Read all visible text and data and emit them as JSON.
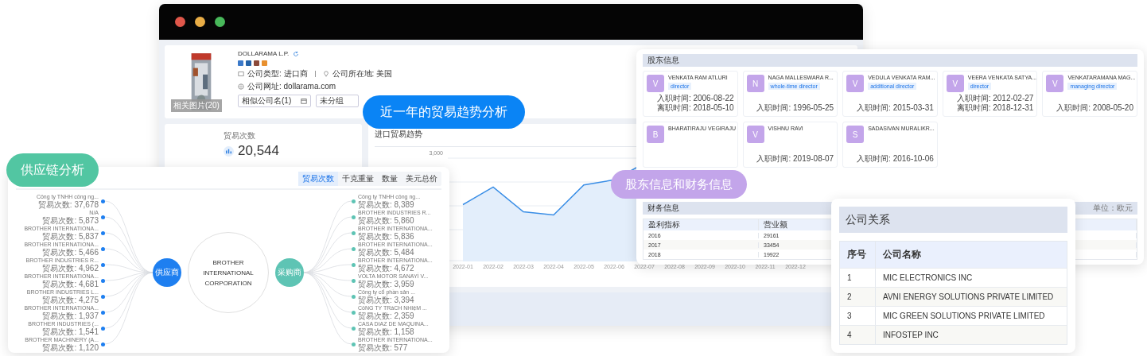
{
  "callouts": [
    {
      "label": "近一年的贸易趋势分析",
      "color": "#0a84f5"
    },
    {
      "label": "供应链分析",
      "color": "#52c6a2"
    },
    {
      "label": "股东信息和财务信息",
      "color": "#c3a5ea"
    }
  ],
  "company": {
    "name": "DOLLARAMA L.P.",
    "photo_caption": "相关图片(20)",
    "type": "公司类型: 进口商",
    "location": "公司所在地: 美国",
    "website": "公司网址: dollarama.com",
    "selects": [
      "相似公司名(1)",
      "未分组"
    ]
  },
  "stats": {
    "label": "贸易次数",
    "value": "20,544"
  },
  "trend": {
    "title": "进口贸易趋势",
    "y_tick": "3,000",
    "x_labels": [
      "2022-01",
      "2022-02",
      "2022-03",
      "2022-04",
      "2022-05",
      "2022-06",
      "2022-07",
      "2022-08",
      "2022-09",
      "2022-10",
      "2022-11",
      "2022-12"
    ]
  },
  "supply_chain": {
    "tabs": [
      {
        "label": "贸易次数",
        "selected": true
      },
      {
        "label": "千克重量",
        "selected": false
      },
      {
        "label": "数量",
        "selected": false
      },
      {
        "label": "美元总价",
        "selected": false
      }
    ],
    "center": "BROTHER INTERNATIONAL CORPORATION",
    "supplier_label": "供应商",
    "buyer_label": "采购商",
    "suppliers": [
      {
        "name": "Công ty TNHH công ng...",
        "count": "贸易次数: 37,678"
      },
      {
        "name": "N/A",
        "count": "贸易次数: 5,873"
      },
      {
        "name": "BROTHER INTERNATIONA...",
        "count": "贸易次数: 5,837"
      },
      {
        "name": "BROTHER INTERNATIONA...",
        "count": "贸易次数: 5,466"
      },
      {
        "name": "BROTHER INDUSTRIES R...",
        "count": "贸易次数: 4,962"
      },
      {
        "name": "BROTHER INTERNATIONA...",
        "count": "贸易次数: 4,681"
      },
      {
        "name": "BROTHER INDUSTRIES L...",
        "count": "贸易次数: 4,275"
      },
      {
        "name": "BROTHER INTERNATIONA...",
        "count": "贸易次数: 1,937"
      },
      {
        "name": "BROTHER INDUSTRIES (...",
        "count": "贸易次数: 1,541"
      },
      {
        "name": "BROTHER MACHINERY (A...",
        "count": "贸易次数: 1,120"
      }
    ],
    "buyers": [
      {
        "name": "Công ty TNHH công ng...",
        "count": "贸易次数: 8,389"
      },
      {
        "name": "BROTHER INDUSTRIES R...",
        "count": "贸易次数: 5,860"
      },
      {
        "name": "BROTHER INTERNATIONA...",
        "count": "贸易次数: 5,836"
      },
      {
        "name": "BROTHER INTERNATIONA...",
        "count": "贸易次数: 5,484"
      },
      {
        "name": "BROTHER INTERNATIONA...",
        "count": "贸易次数: 4,672"
      },
      {
        "name": "VOLTA MOTOR SANAYİ V...",
        "count": "贸易次数: 3,959"
      },
      {
        "name": "Công ty cổ phần sản ...",
        "count": "贸易次数: 3,394"
      },
      {
        "name": "CôNG TY TRáCH NHIệM ...",
        "count": "贸易次数: 2,359"
      },
      {
        "name": "CASA DIAZ DE MAQUINA...",
        "count": "贸易次数: 1,158"
      },
      {
        "name": "BROTHER INTERNATIONA...",
        "count": "贸易次数: 577"
      }
    ]
  },
  "shareholders": {
    "title": "股东信息",
    "people": [
      {
        "initial": "V",
        "name": "VENKATA RAM ATLURI",
        "role": "director",
        "dates": [
          "入职时间: 2006-08-22",
          "离职时间: 2018-05-10"
        ]
      },
      {
        "initial": "N",
        "name": "NAGA MALLESWARA R...",
        "role": "whole-time director",
        "dates": [
          "入职时间: 1996-05-25"
        ]
      },
      {
        "initial": "V",
        "name": "VEDULA VENKATA RAM...",
        "role": "additional director",
        "dates": [
          "入职时间: 2015-03-31"
        ]
      },
      {
        "initial": "V",
        "name": "VEERA VENKATA SATYA...",
        "role": "director",
        "dates": [
          "入职时间: 2012-02-27",
          "离职时间: 2018-12-31"
        ]
      },
      {
        "initial": "V",
        "name": "VENKATARAMANA MAG...",
        "role": "managing director",
        "dates": [
          "入职时间: 2008-05-20"
        ]
      },
      {
        "initial": "B",
        "name": "BHARATIRAJU VEGIRAJU"
      },
      {
        "initial": "V",
        "name": "VISHNU RAVI",
        "dates": [
          "入职时间: 2019-08-07"
        ]
      },
      {
        "initial": "S",
        "name": "SADASIVAN MURALIKR...",
        "dates": [
          "入职时间: 2016-10-06"
        ]
      }
    ]
  },
  "finance": {
    "title": "财务信息",
    "unit": "单位：欧元",
    "columns": [
      "盈利指标",
      "营业额"
    ],
    "rows": [
      [
        "2016",
        "29161"
      ],
      [
        "2017",
        "33454"
      ],
      [
        "2018",
        "19922"
      ]
    ]
  },
  "relations": {
    "title": "公司关系",
    "columns": [
      "序号",
      "公司名称"
    ],
    "rows": [
      [
        "1",
        "MIC ELECTRONICS INC"
      ],
      [
        "2",
        "AVNI ENERGY SOLUTIONS PRIVATE LIMITED"
      ],
      [
        "3",
        "MIC GREEN SOLUTIONS PRIVATE LIMITED"
      ],
      [
        "4",
        "INFOSTEP INC"
      ]
    ]
  }
}
